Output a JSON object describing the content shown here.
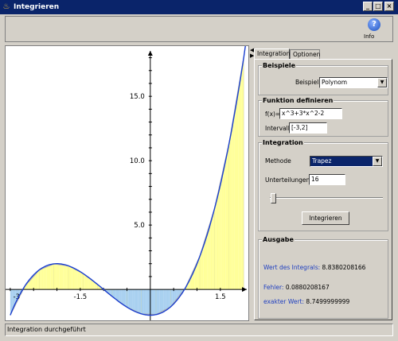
{
  "window": {
    "title": "Integrieren",
    "app_icon": "java-cup-icon",
    "btn_min": "_",
    "btn_max": "□",
    "btn_close": "×"
  },
  "toolbar": {
    "info_label": "Info",
    "info_glyph": "?",
    "info_icon": "help-icon"
  },
  "colors": {
    "title_bg": "#0a246a",
    "curve": "#1a3fd0",
    "positive_fill": "#ffff99",
    "negative_fill": "#a8d0f0",
    "approx_curve": "#b0b0b0"
  },
  "chart_data": {
    "type": "line",
    "function": "x^3+3*x^2-2",
    "xlim": [
      -3.1,
      2.1
    ],
    "ylim": [
      -2.4,
      18.9
    ],
    "x_ticks": [
      -3,
      -1.5,
      1.5
    ],
    "x_tick_labels": [
      "-3",
      "-1.5",
      "1.5"
    ],
    "y_ticks": [
      5,
      10,
      15
    ],
    "y_tick_labels": [
      "5.0",
      "10.0",
      "15.0"
    ],
    "interval": [
      -3,
      2
    ],
    "subdivisions": 16,
    "method": "trapezoid",
    "grid": false
  },
  "tabs": [
    {
      "label": "Integration"
    },
    {
      "label": "Optionen"
    }
  ],
  "beispiele": {
    "legend": "Beispiele",
    "label": "Beispiel",
    "value": "Polynom"
  },
  "funktion": {
    "legend": "Funktion definieren",
    "fx_label": "f(x)=",
    "fx_value": "x^3+3*x^2-2",
    "intervall_label": "Intervall",
    "intervall_value": "[-3,2]"
  },
  "integration": {
    "legend": "Integration",
    "methode_label": "Methode",
    "methode_value": "Trapez",
    "unterteilungen_label": "Unterteilungen",
    "unterteilungen_value": "16",
    "slider_value": 16,
    "button": "Integrieren"
  },
  "ausgabe": {
    "legend": "Ausgabe",
    "wert_key": "Wert des Integrals:",
    "wert_val": "8.8380208166",
    "fehler_key": "Fehler:",
    "fehler_val": "0.0880208167",
    "exakt_key": "exakter Wert:",
    "exakt_val": "8.7499999999"
  },
  "status": "Integration durchgeführt"
}
